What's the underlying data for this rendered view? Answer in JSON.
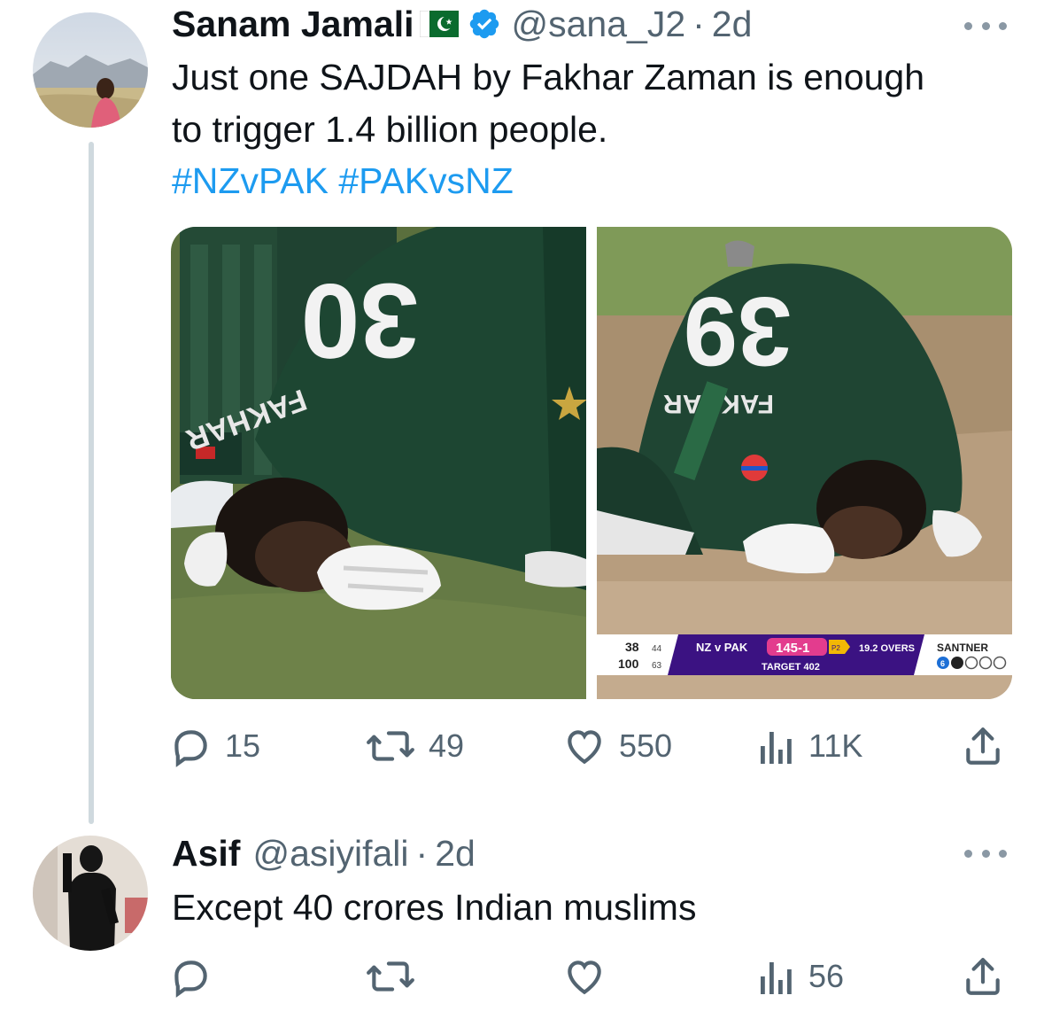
{
  "tweet1": {
    "author_name": "Sanam Jamali",
    "handle": "@sana_J2",
    "separator": "·",
    "time": "2d",
    "text_line1": "Just one SAJDAH by Fakhar Zaman is enough",
    "text_line2": "to trigger 1.4 billion people.",
    "hashtags": "#NZvPAK #PAKvsNZ",
    "photo1": {
      "jersey_number": "30",
      "jersey_name": "FAKHAR"
    },
    "photo2": {
      "jersey_number": "39",
      "jersey_name": "FAKHAR",
      "scorebug": {
        "batter_row1": "38",
        "batter_row1_balls": "44",
        "batter_row2": "100",
        "batter_row2_balls": "63",
        "match": "NZ v PAK",
        "score": "145-1",
        "powerplay": "P2",
        "overs": "19.2 OVERS",
        "target": "TARGET 402",
        "bowler": "SANTNER",
        "bowler_ball": "6"
      }
    },
    "metrics": {
      "replies": "15",
      "retweets": "49",
      "likes": "550",
      "views": "11K"
    }
  },
  "tweet2": {
    "author_name": "Asif",
    "handle": "@asiyifali",
    "separator": "·",
    "time": "2d",
    "text": "Except 40 crores Indian muslims",
    "metrics": {
      "replies": "",
      "retweets": "",
      "likes": "",
      "views": "56"
    }
  },
  "icons": [
    "reply-icon",
    "retweet-icon",
    "like-icon",
    "views-icon",
    "share-icon",
    "more-icon",
    "verified-icon",
    "pakistan-flag-icon"
  ],
  "colors": {
    "link": "#1d9bf0",
    "secondary_text": "#536471",
    "verified": "#1d9bf0",
    "thread_line": "#cfd9de"
  }
}
